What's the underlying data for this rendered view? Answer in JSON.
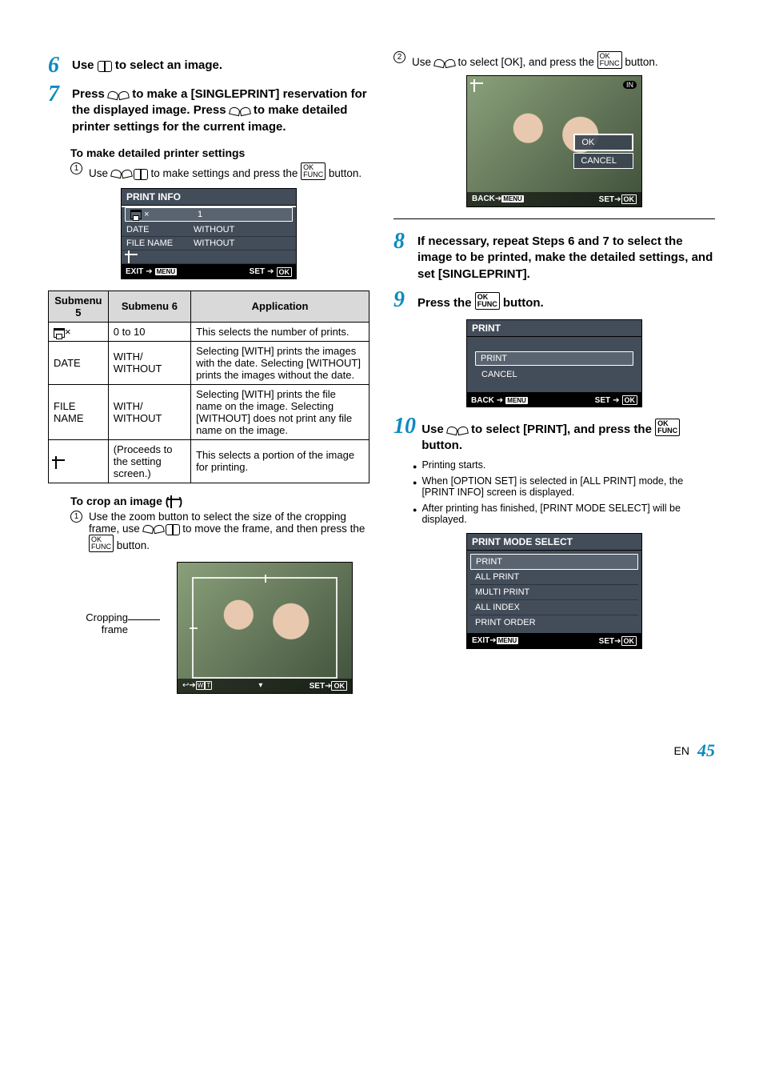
{
  "left": {
    "step6": {
      "num": "6",
      "text": "Use  to select an image."
    },
    "step7": {
      "num": "7",
      "text": "Press  to make a [SINGLEPRINT] reservation for the displayed image. Press  to make detailed printer settings for the current image."
    },
    "sub_detailed": "To make detailed printer settings",
    "detailed_line": "Use  to make settings and press the  button.",
    "print_info_screen": {
      "title": "PRINT INFO",
      "rows": [
        {
          "label_icon": true,
          "label_suffix": "×",
          "value": "1"
        },
        {
          "label": "DATE",
          "value": "WITHOUT"
        },
        {
          "label": "FILE NAME",
          "value": "WITHOUT"
        },
        {
          "label_crop": true,
          "value": ""
        }
      ],
      "bar_left_label": "EXIT",
      "bar_right_label": "SET"
    },
    "settings_table": {
      "headers": [
        "Submenu 5",
        "Submenu 6",
        "Application"
      ],
      "rows": [
        {
          "c1_icon": true,
          "c1_suffix": "×",
          "c2": "0 to 10",
          "c3": "This selects the number of prints."
        },
        {
          "c1": "DATE",
          "c2": "WITH/\nWITHOUT",
          "c3": "Selecting [WITH] prints the images with the date. Selecting [WITHOUT] prints the images without the date."
        },
        {
          "c1": "FILE NAME",
          "c2": "WITH/\nWITHOUT",
          "c3": "Selecting [WITH] prints the file name on the image. Selecting [WITHOUT] does not print any file name on the image."
        },
        {
          "c1_crop": true,
          "c2": "(Proceeds to the setting screen.)",
          "c3": "This selects a portion of the image for printing."
        }
      ]
    },
    "crop_head": "To crop an image (",
    "crop_head_tail": ")",
    "crop_line": "Use the zoom button to select the size of the cropping frame, use  to move the frame, and then press the  button.",
    "crop_label": "Cropping frame",
    "crop_bar_right": "SET"
  },
  "right": {
    "step2_line": "Use  to select [OK], and press the  button.",
    "ok_screen": {
      "opt1": "OK",
      "opt2": "CANCEL",
      "in": "IN",
      "bar_left": "BACK",
      "bar_right": "SET"
    },
    "step8": {
      "num": "8",
      "text": "If necessary, repeat Steps 6 and 7 to select the image to be printed, make the detailed settings, and set [SINGLEPRINT]."
    },
    "step9": {
      "num": "9",
      "text": "Press the  button."
    },
    "print_screen": {
      "title": "PRINT",
      "opt1": "PRINT",
      "opt2": "CANCEL",
      "bar_left": "BACK",
      "bar_right": "SET"
    },
    "step10": {
      "num": "10",
      "text": "Use  to select [PRINT], and press the  button."
    },
    "bullets": [
      "Printing starts.",
      "When [OPTION SET] is selected in [ALL PRINT] mode, the [PRINT INFO] screen is displayed.",
      "After printing has finished, [PRINT MODE SELECT] will be displayed."
    ],
    "pms": {
      "title": "PRINT MODE SELECT",
      "rows": [
        "PRINT",
        "ALL PRINT",
        "MULTI PRINT",
        "ALL INDEX",
        "PRINT ORDER"
      ],
      "bar_left": "EXIT",
      "bar_right": "SET"
    }
  },
  "footer": {
    "lang": "EN",
    "page": "45"
  }
}
